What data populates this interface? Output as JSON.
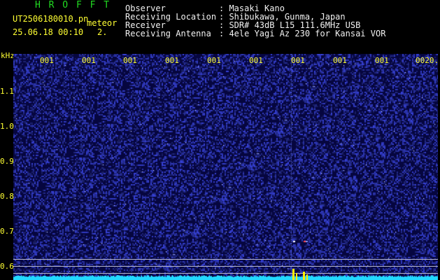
{
  "header": {
    "program_name": "H R O F F T",
    "filename": "UT2506180010.pn",
    "tag": "meteor",
    "datetime": "25.06.18 00:10",
    "index": "2.",
    "fields": [
      {
        "label": "Observer",
        "value": ": Masaki Kano"
      },
      {
        "label": "Receiving Location",
        "value": ": Shibukawa, Gunma, Japan"
      },
      {
        "label": "Receiver",
        "value": ": SDR# 43dB L15 111.6MHz USB"
      },
      {
        "label": "Receiving Antenna",
        "value": ": 4ele Yagi Az 230 for Kansai VOR"
      }
    ]
  },
  "plot": {
    "y_unit": "kHz",
    "y_ticks": [
      "1.1",
      "1.0",
      "0.9",
      "0.8",
      "0.7",
      "0.6"
    ],
    "x_ticks": [
      "001",
      "001",
      "001",
      "001",
      "001",
      "001",
      "001",
      "001",
      "001",
      "0020."
    ],
    "colors": {
      "background": "#06063f",
      "noise": "#2a35c8",
      "spectrum": "#22d8ff",
      "echo": "#ffee00",
      "text": "#ffff33"
    }
  }
}
